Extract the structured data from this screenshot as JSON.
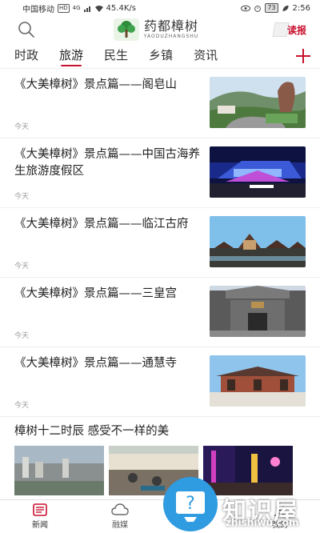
{
  "status_bar": {
    "carrier": "中国移动",
    "hd_badge": "HD",
    "network": "4G",
    "speed": "45.4K/s",
    "battery": "73",
    "time": "2:56"
  },
  "header": {
    "brand_name": "药都樟树",
    "brand_pinyin": "YAODUZHANGSHU",
    "read_label": "读报",
    "search_icon": "search-icon"
  },
  "tabs": [
    {
      "label": "时政",
      "active": false
    },
    {
      "label": "旅游",
      "active": true
    },
    {
      "label": "民生",
      "active": false
    },
    {
      "label": "乡镇",
      "active": false
    },
    {
      "label": "资讯",
      "active": false
    }
  ],
  "news": [
    {
      "title": "《大美樟树》景点篇——阁皂山",
      "time": "今天",
      "thumb": "mountain-photo"
    },
    {
      "title": "《大美樟树》景点篇——中国古海养生旅游度假区",
      "time": "今天",
      "thumb": "night-resort-photo"
    },
    {
      "title": "《大美樟树》景点篇——临江古府",
      "time": "今天",
      "thumb": "ancient-town-photo"
    },
    {
      "title": "《大美樟树》景点篇——三皇宫",
      "time": "今天",
      "thumb": "palace-gate-photo"
    },
    {
      "title": "《大美樟树》景点篇——通慧寺",
      "time": "今天",
      "thumb": "temple-photo"
    }
  ],
  "feature": {
    "title": "樟树十二时辰 感受不一样的美"
  },
  "bottom_nav": [
    {
      "label": "新闻",
      "icon": "news-icon",
      "active": true
    },
    {
      "label": "融媒",
      "icon": "cloud-icon",
      "active": false
    },
    {
      "label": "民",
      "icon": "service-icon",
      "active": false
    },
    {
      "label": "我的",
      "icon": "user-icon",
      "active": false
    }
  ],
  "watermark": {
    "text": "知识屋",
    "url": "zhishiwu.com"
  },
  "colors": {
    "accent": "#c8102e",
    "watermark_blue": "#2f9be0"
  }
}
